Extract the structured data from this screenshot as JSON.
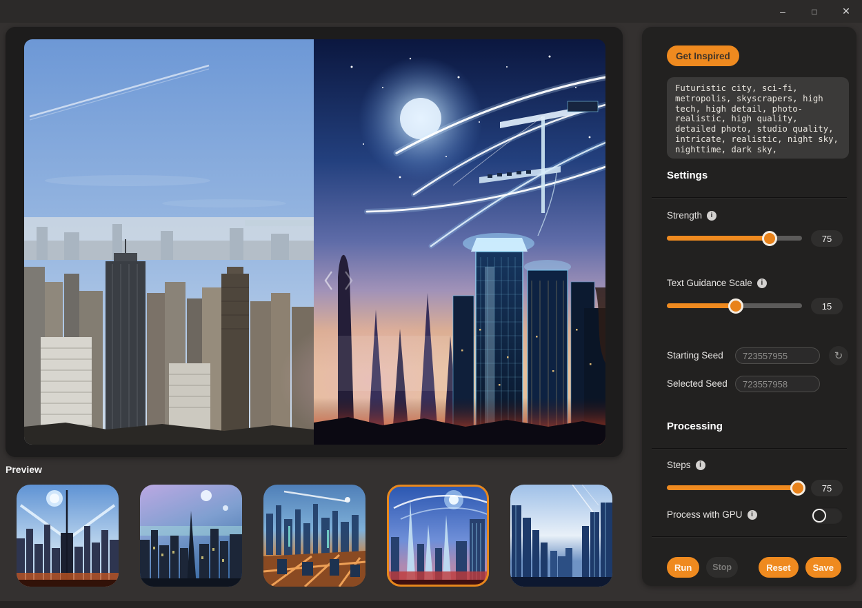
{
  "titlebar": {
    "minimize_icon": "–",
    "maximize_icon": "□",
    "close_icon": "✕"
  },
  "hero": {
    "compare_prev_icon": "‹",
    "compare_next_icon": "›"
  },
  "preview": {
    "label": "Preview",
    "thumbnails": [
      {
        "name": "twin-light-beams-city",
        "selected": false
      },
      {
        "name": "purple-dusk-spire-city",
        "selected": false
      },
      {
        "name": "aerial-orange-blue-city",
        "selected": false
      },
      {
        "name": "crystal-towers-red-glow-city",
        "selected": true
      },
      {
        "name": "blue-mist-towers-city",
        "selected": false
      }
    ]
  },
  "sidebar": {
    "get_inspired_label": "Get Inspired",
    "prompt": "Futuristic city, sci-fi, metropolis, skyscrapers, high tech, high detail, photo-realistic, high quality, detailed photo, studio quality, intricate, realistic, night sky, nighttime, dark sky,",
    "icons": {
      "info": "i",
      "refresh": "↻"
    },
    "settings": {
      "heading": "Settings",
      "strength": {
        "label": "Strength",
        "value": "75",
        "fill": "76%"
      },
      "guidance": {
        "label": "Text Guidance Scale",
        "value": "15",
        "fill": "51%"
      },
      "starting_seed": {
        "label": "Starting Seed",
        "value": "723557955"
      },
      "selected_seed": {
        "label": "Selected Seed",
        "value": "723557958"
      }
    },
    "processing": {
      "heading": "Processing",
      "steps": {
        "label": "Steps",
        "value": "75",
        "fill": "97%"
      },
      "gpu": {
        "label": "Process with GPU",
        "enabled": false
      }
    },
    "actions": {
      "run": "Run",
      "stop": "Stop",
      "reset": "Reset",
      "save": "Save"
    }
  },
  "colors": {
    "accent": "#ef8a1f",
    "selected_border": "#e8881c"
  }
}
